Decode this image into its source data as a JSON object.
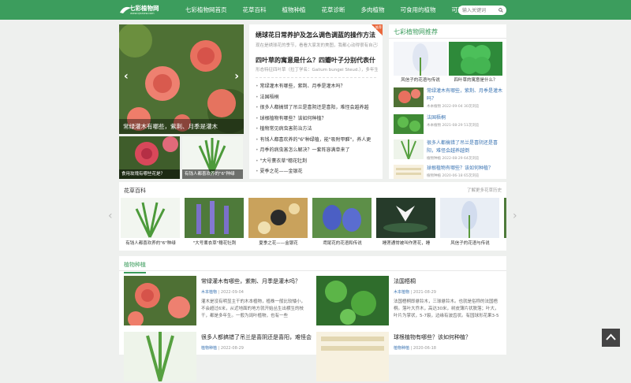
{
  "header": {
    "logo": "七彩植物网",
    "logo_sub": "www.qicaizw.com",
    "menu": [
      "七彩植物网首页",
      "花草百科",
      "植物种植",
      "花草诊断",
      "多肉植物",
      "可食用的植物",
      "可药用的植物"
    ],
    "search_placeholder": "输入关键词"
  },
  "slider": {
    "caption": "常绿灌木有哪些，紫荆、月季是灌木",
    "thumbs": [
      "食用玫瑰有哪些花是？",
      "有钱人都喜欢养的\"6\"种绿"
    ]
  },
  "headlines": {
    "h1": "绣球花日常养护及怎么调色调蓝的操作方法",
    "h1_desc": "现在是绣球花的季节，看看大家发的美图，我都心动得很有自己种花的",
    "badge": "推荐",
    "h2": "四叶草的寓意是什么？四瓣叶子分别代表什",
    "h2_desc": "形态特征四叶草（拉丁学名：Galium bungei Steud.），多年生草本植物"
  },
  "mid_list": [
    "常绿灌木有哪些，紫荆、月季是灌木吗？",
    "法国梧桐",
    "很多人都搞错了吊兰是喜阴还是喜阳，难怪会越养越",
    "球根植物有哪些？该如何种植？",
    "植物常见病虫害防治方法",
    "有钱人都喜欢养的\"6\"种绿植，能\"吸附甲醛\"，养人更",
    "月季的病虫害怎么解决？一套阵容满单来了",
    "\"大号薰衣草\"穗花牡荆",
    "夏季之花——金银花"
  ],
  "recommend": {
    "title": "七彩植物网推荐",
    "images": [
      {
        "caption": "风信子的花语与传说"
      },
      {
        "caption": "四叶草的寓意是什么？"
      }
    ],
    "items": [
      {
        "title": "常绿灌木有哪些，紫荆、月季是灌木吗？",
        "cat": "木本植物",
        "date": "2022-09-04",
        "views": "30次浏览"
      },
      {
        "title": "法国梧桐",
        "cat": "木本植物",
        "date": "2021-08-29",
        "views": "51次浏览"
      },
      {
        "title": "很多人都搞错了吊兰是喜阴还是喜阳，难怪会越养越倒",
        "cat": "植物种植",
        "date": "2022-08-29",
        "views": "64次浏览"
      },
      {
        "title": "球根植物有哪些？该如何种植？",
        "cat": "植物种植",
        "date": "2020-06-18",
        "views": "65次浏览"
      }
    ]
  },
  "baike": {
    "title": "花草百科",
    "more": "了解更多花草历史",
    "items": [
      "有钱人都喜欢养的\"6\"种绿",
      "\"大号薰衣草\"穗花牡荆",
      "夏季之花——金银花",
      "鸢尾花的花语和传说",
      "睡莲通常被叫作莲花，睡",
      "风信子的花语与传说"
    ]
  },
  "planting": {
    "title": "植物种植",
    "articles": [
      {
        "title": "常绿灌木有哪些，紫荆、月季是灌木吗？",
        "cat": "木本植物",
        "date": "2022-09-04",
        "desc": "灌木是没有明显主干的木本植物，植株一般比较矮小，不会超过6米，从近地面的地方就开始丛生出横生的枝干，都是多年生。一般为阔叶植物，也有一些"
      },
      {
        "title": "法国梧桐",
        "cat": "木本植物",
        "date": "2021-08-29",
        "desc": "法国梧桐即悬铃木，三球悬铃木。也就是俗称的法国梧桐。落叶大乔木，高达30米，树皮薄片状脱落；叶大，叶片为掌状，5-7裂，边缘有波齿状。有园球形花果3-5"
      },
      {
        "title": "很多人都搞错了吊兰是喜阴还是喜阳，难怪会",
        "cat": "植物种植",
        "date": "2022-08-29",
        "desc": ""
      },
      {
        "title": "球根植物有哪些？该如何种植？",
        "cat": "植物种植",
        "date": "2020-06-18",
        "desc": ""
      }
    ]
  },
  "colors": {
    "green": "#3c9d5d",
    "blue": "#3c75b3",
    "orange": "#e9673b"
  }
}
